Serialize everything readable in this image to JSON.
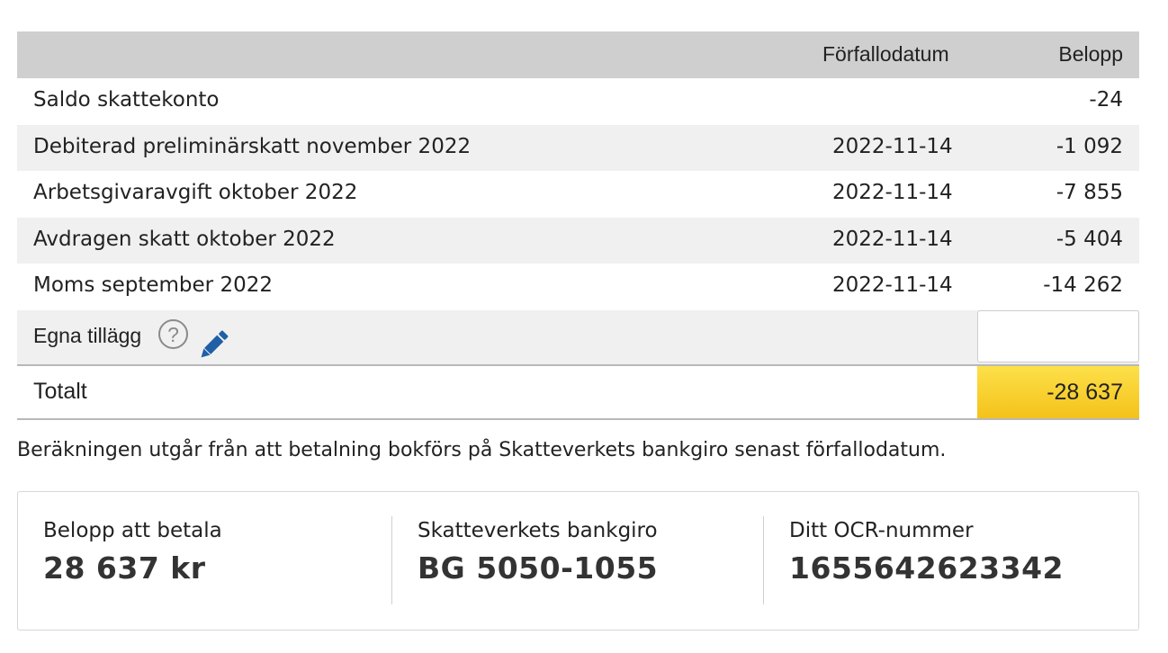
{
  "table": {
    "header": {
      "due_date": "Förfallodatum",
      "amount": "Belopp"
    },
    "rows": [
      {
        "description": "Saldo skattekonto",
        "date": "",
        "amount": "-24"
      },
      {
        "description": "Debiterad preliminärskatt november 2022",
        "date": "2022-11-14",
        "amount": "-1 092"
      },
      {
        "description": "Arbetsgivaravgift oktober 2022",
        "date": "2022-11-14",
        "amount": "-7 855"
      },
      {
        "description": "Avdragen skatt oktober 2022",
        "date": "2022-11-14",
        "amount": "-5 404"
      },
      {
        "description": "Moms september 2022",
        "date": "2022-11-14",
        "amount": "-14 262"
      }
    ],
    "own_additions": {
      "label": "Egna tillägg",
      "help_symbol": "?",
      "value": ""
    },
    "total": {
      "label": "Totalt",
      "value": "-28 637"
    }
  },
  "note": "Beräkningen utgår från att betalning bokförs på Skatteverkets bankgiro senast förfallodatum.",
  "payment": {
    "amount_label": "Belopp att betala",
    "amount_value": "28 637 kr",
    "bankgiro_label": "Skatteverkets bankgiro",
    "bankgiro_value": "BG 5050-1055",
    "ocr_label": "Ditt OCR-nummer",
    "ocr_value": "1655642623342"
  },
  "icons": {
    "help": "question-circle-icon",
    "edit": "pencil-icon"
  },
  "colors": {
    "header_bg": "#cfcfcf",
    "total_highlight": "#f9d030",
    "pencil": "#1f5fa6"
  }
}
